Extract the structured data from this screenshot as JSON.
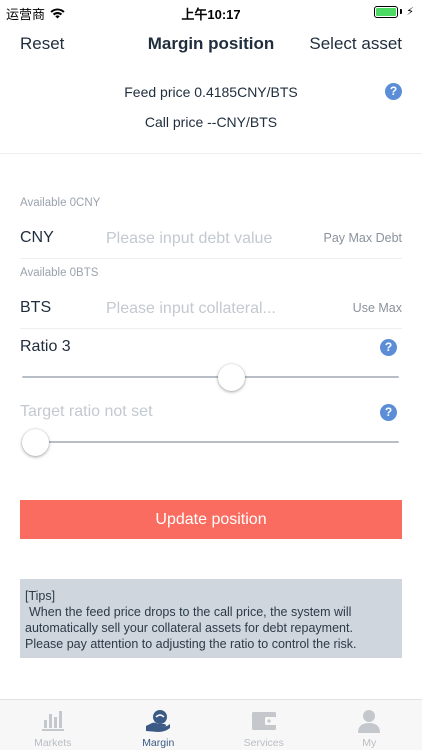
{
  "status_bar": {
    "carrier": "运营商",
    "time": "上午10:17"
  },
  "nav": {
    "left": "Reset",
    "title": "Margin position",
    "right": "Select asset"
  },
  "prices": {
    "feed": "Feed price 0.4185CNY/BTS",
    "call": "Call price --CNY/BTS"
  },
  "debt": {
    "available": "Available 0CNY",
    "unit": "CNY",
    "placeholder": "Please input debt value",
    "action": "Pay Max Debt"
  },
  "collateral": {
    "available": "Available 0BTS",
    "unit": "BTS",
    "placeholder": "Please input collateral...",
    "action": "Use Max"
  },
  "ratio": {
    "label": "Ratio 3",
    "slider_fraction": 0.56
  },
  "target_ratio": {
    "label": "Target ratio not set",
    "slider_fraction": 0.0
  },
  "update_button": "Update position",
  "tips": {
    "line1": "[Tips]",
    "line2": "When the feed price drops to the call price, the system will",
    "line3": "automatically sell your collateral assets for debt repayment.",
    "line4": "Please pay attention to adjusting the ratio to control the risk."
  },
  "tabs": [
    {
      "label": "Markets",
      "icon": "chart-bars-icon",
      "active": false
    },
    {
      "label": "Margin",
      "icon": "hand-coin-icon",
      "active": true
    },
    {
      "label": "Services",
      "icon": "wallet-icon",
      "active": false
    },
    {
      "label": "My",
      "icon": "person-icon",
      "active": false
    }
  ],
  "colors": {
    "accent": "#f96c5f",
    "help_icon": "#5b8ed6",
    "tips_bg": "#cfd6de",
    "active_tab": "#3b5a86"
  },
  "help_symbol": "?"
}
